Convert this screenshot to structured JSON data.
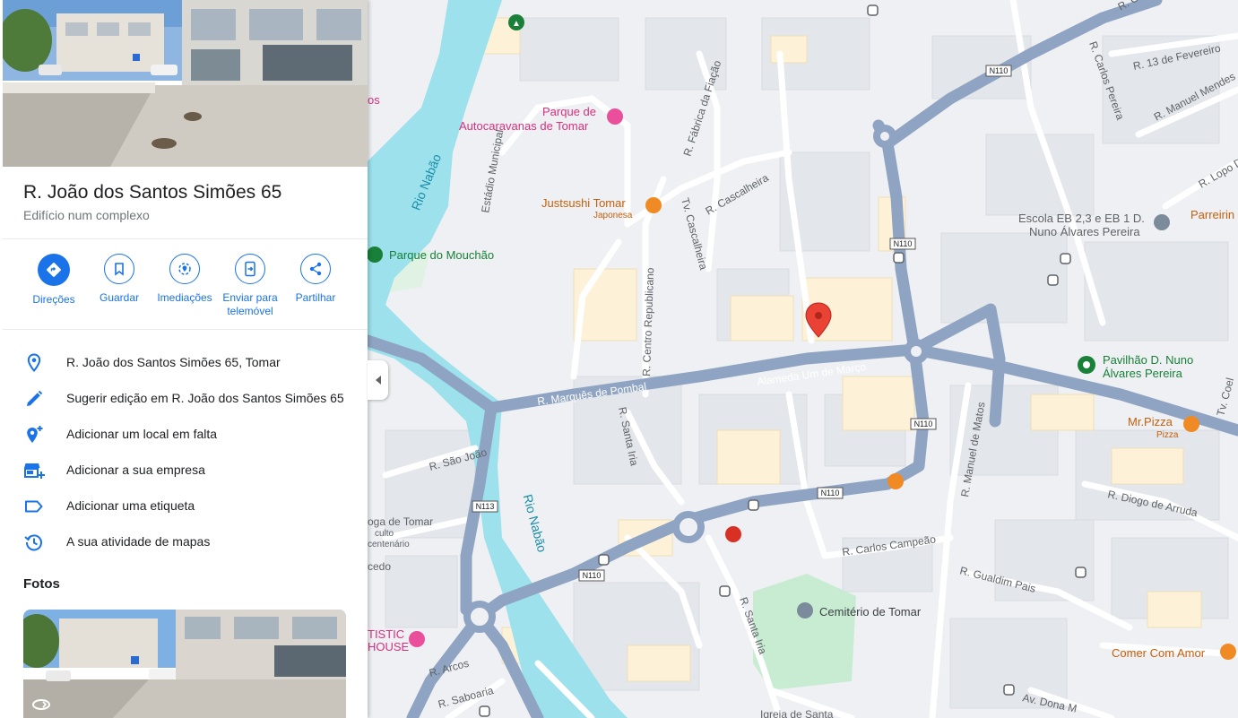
{
  "place": {
    "title": "R. João dos Santos Simões 65",
    "subtitle": "Edifício num complexo"
  },
  "actions": [
    {
      "label": "Direções",
      "icon": "directions-icon"
    },
    {
      "label": "Guardar",
      "icon": "bookmark-icon"
    },
    {
      "label": "Imediações",
      "icon": "nearby-icon"
    },
    {
      "label": "Enviar para telemóvel",
      "icon": "send-to-phone-icon"
    },
    {
      "label": "Partilhar",
      "icon": "share-icon"
    }
  ],
  "details": [
    {
      "text": "R. João dos Santos Simões 65, Tomar",
      "icon": "location-pin-icon"
    },
    {
      "text": "Sugerir edição em R. João dos Santos Simões 65",
      "icon": "pencil-icon"
    },
    {
      "text": "Adicionar um local em falta",
      "icon": "add-location-icon"
    },
    {
      "text": "Adicionar a sua empresa",
      "icon": "add-business-icon"
    },
    {
      "text": "Adicionar uma etiqueta",
      "icon": "label-icon"
    },
    {
      "text": "A sua atividade de mapas",
      "icon": "history-icon"
    }
  ],
  "photos": {
    "heading": "Fotos"
  },
  "colors": {
    "accent": "#1a73e8",
    "water": "#9ce1ec",
    "road": "#8fa4c2",
    "park": "#c8ecd2",
    "marker": "#ea4335"
  },
  "map": {
    "rivers": [
      "Rio Nabão",
      "Rio Nabão"
    ],
    "streets": [
      "R. Comendador",
      "R. Carlos Pereira",
      "R. 13 de Fevereiro",
      "R. Manuel Mendes",
      "R. Lopo D",
      "R. Fábrica da Fiação",
      "Estádio Municipal",
      "R. Cascalheira",
      "Tv. Cascalheira",
      "R. Centro Republicano",
      "R. Marquês de Pombal",
      "Alameda Um de Março",
      "R. Santa Iria",
      "R. São João",
      "R. Manuel de Matos",
      "R. Diogo de Arruda",
      "R. Carlos Campeão",
      "R. Gualdim Pais",
      "R. Santa Iria",
      "R. Arcos",
      "R. Saboaria",
      "Av. Dona M",
      "Tv. Coel",
      "oga de Tomar",
      "cedo",
      "culto",
      "centenário",
      "Igreja de Santa"
    ],
    "road_numbers": [
      "N110",
      "N110",
      "N110",
      "N110",
      "N110",
      "N113"
    ],
    "pois": [
      {
        "name": "Parque de Autocaravanas de Tomar",
        "lines": [
          "Parque de",
          "Autocaravanas de Tomar"
        ]
      },
      {
        "name": "Justsushi Tomar",
        "sub": "Japonesa"
      },
      {
        "name": "Parque do Mouchão"
      },
      {
        "name": "Escola EB 2,3 e EB 1 D. Nuno Álvares Pereira",
        "lines": [
          "Escola EB 2,3 e EB 1 D.",
          "Nuno Álvares Pereira"
        ]
      },
      {
        "name": "Pavilhão D. Nuno Álvares Pereira",
        "lines": [
          "Pavilhão D. Nuno",
          "Álvares Pereira"
        ]
      },
      {
        "name": "Mr.Pizza",
        "sub": "Pizza"
      },
      {
        "name": "Cemitério de Tomar"
      },
      {
        "name": "Comer Com Amor"
      },
      {
        "name": "Parreirin"
      },
      {
        "name": "TISTIC HOUSE",
        "lines": [
          "TISTIC",
          "HOUSE"
        ]
      }
    ],
    "cut_label": "os"
  }
}
